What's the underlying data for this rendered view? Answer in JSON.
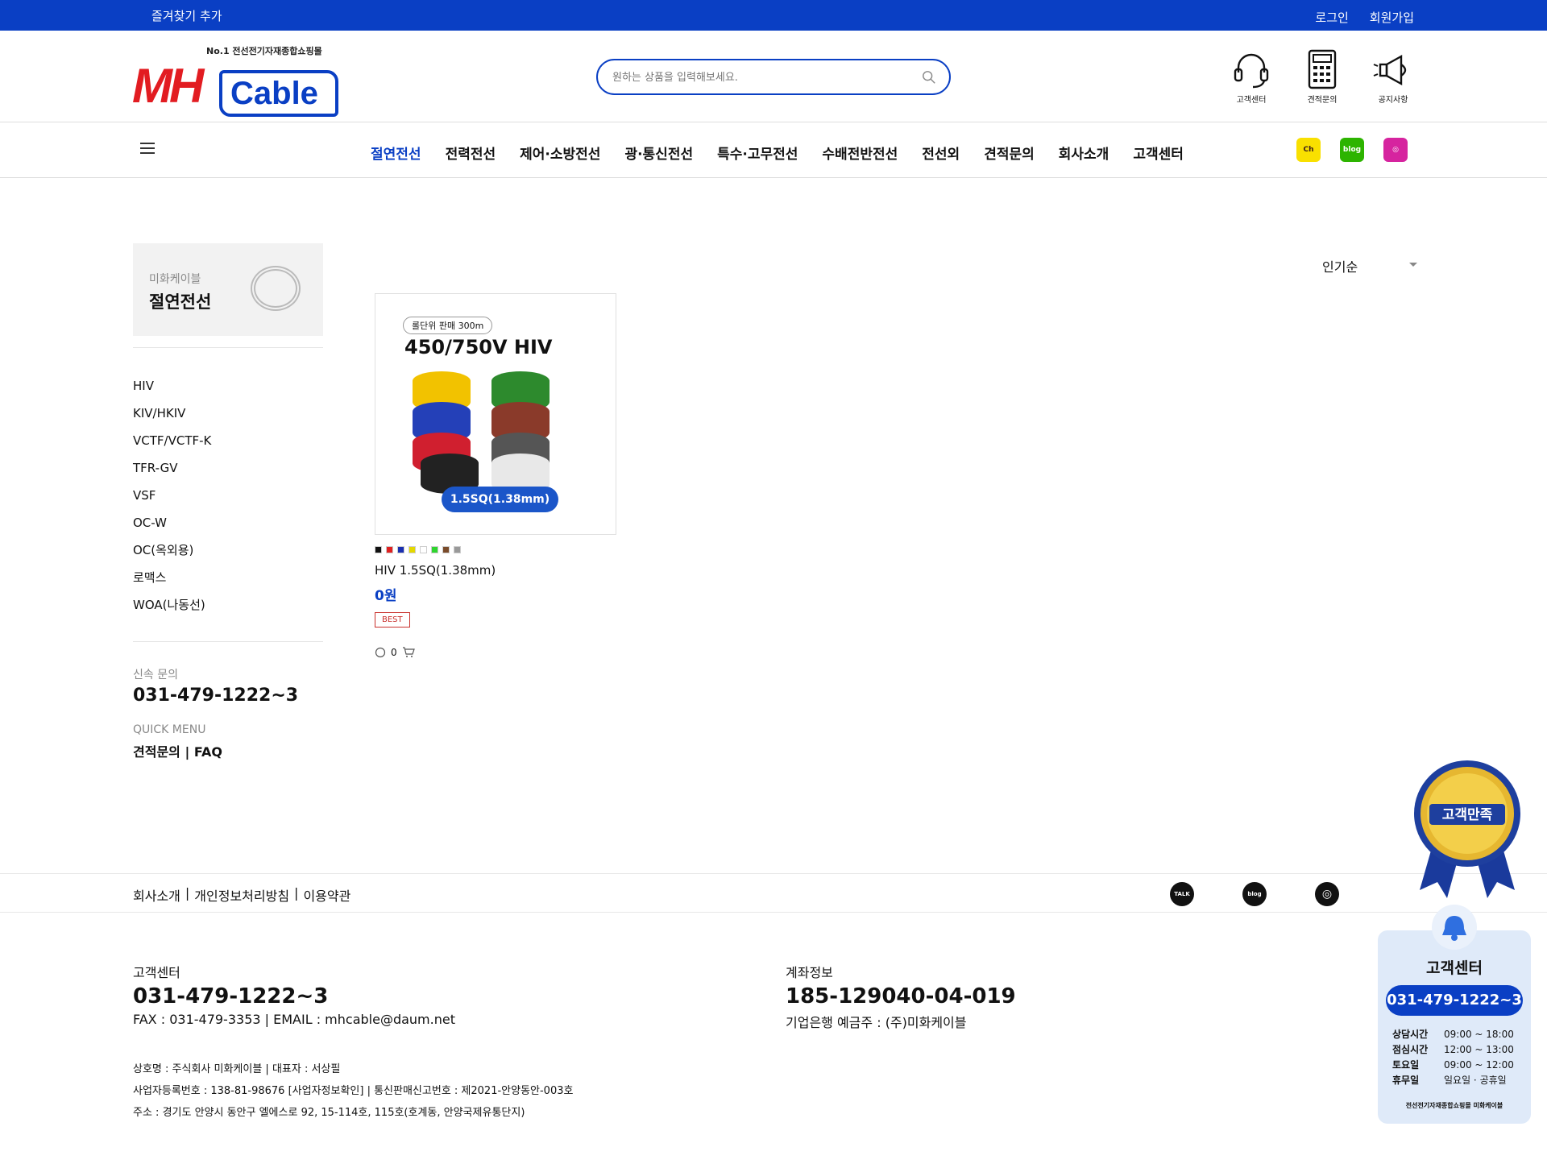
{
  "topbar": {
    "favorite": "즐겨찾기 추가",
    "login": "로그인",
    "signup": "회원가입"
  },
  "logo": {
    "tagline": "No.1 전선전기자재종합쇼핑몰",
    "brand_mh": "MH",
    "brand_cable": "Cable"
  },
  "search": {
    "placeholder": "원하는 상품을 입력해보세요."
  },
  "header_icons": [
    {
      "label": "고객센터",
      "icon": "headset-icon"
    },
    {
      "label": "견적문의",
      "icon": "calculator-icon"
    },
    {
      "label": "공지사항",
      "icon": "megaphone-icon"
    }
  ],
  "nav": {
    "items": [
      "절연전선",
      "전력전선",
      "제어·소방전선",
      "광·통신전선",
      "특수·고무전선",
      "수배전반전선",
      "전선외",
      "견적문의",
      "회사소개",
      "고객센터"
    ],
    "active": "절연전선",
    "socials": [
      {
        "name": "kakao-channel",
        "text": "Ch",
        "color": "#f9e000"
      },
      {
        "name": "blog",
        "text": "blog",
        "color": "#2db400"
      },
      {
        "name": "instagram",
        "text": "◎",
        "color": "#d6249f"
      }
    ]
  },
  "sidebar": {
    "category_sub": "미화케이블",
    "category_title": "절연전선",
    "items": [
      "HIV",
      "KIV/HKIV",
      "VCTF/VCTF-K",
      "TFR-GV",
      "VSF",
      "OC-W",
      "OC(옥외용)",
      "로맥스",
      "WOA(나동선)"
    ],
    "inquiry_label": "신속 문의",
    "inquiry_phone": "031-479-1222~3",
    "quick_label": "QUICK MENU",
    "quick_links": "견적문의 | FAQ"
  },
  "sort": {
    "selected": "인기순"
  },
  "product": {
    "badge": "롤단위 판매 300m",
    "title": "450/750V HIV",
    "spec": "1.5SQ(1.38mm)",
    "swatches": [
      "#111111",
      "#e02020",
      "#1a2fb0",
      "#e4d800",
      "#ffffff",
      "#2fd52f",
      "#7a4b2a",
      "#999999"
    ],
    "name": "HIV 1.5SQ(1.38mm)",
    "price": "0원",
    "label": "BEST",
    "reviews": "0"
  },
  "footer": {
    "links": [
      "회사소개",
      "|",
      "개인정보처리방침",
      "|",
      "이용약관"
    ],
    "cs_label": "고객센터",
    "cs_phone": "031-479-1222~3",
    "cs_contact": "FAX : 031-479-3353  | EMAIL : mhcable@daum.net",
    "account_label": "계좌정보",
    "account_number": "185-129040-04-019",
    "account_holder": "기업은행 예금주 : (주)미화케이블",
    "info_lines": [
      "상호명 : 주식회사 미화케이블 | 대표자 : 서상필",
      "사업자등록번호 : 138-81-98676 [사업자정보확인]  |  통신판매신고번호 : 제2021-안양동안-003호",
      "주소 : 경기도 안양시 동안구 엘에스로 92, 15-114호, 115호(호계동, 안양국제유통단지)"
    ]
  },
  "medal": {
    "text": "고객만족"
  },
  "widget": {
    "title": "고객센터",
    "phone": "031-479-1222~3",
    "hours": [
      {
        "label": "상담시간",
        "value": "09:00 ~ 18:00"
      },
      {
        "label": "점심시간",
        "value": "12:00 ~ 13:00"
      },
      {
        "label": "토요일",
        "value": "09:00 ~ 12:00"
      },
      {
        "label": "휴무일",
        "value": "일요일 · 공휴일"
      }
    ],
    "footer": "전선전기자재종합쇼핑몰 미화케이블"
  }
}
